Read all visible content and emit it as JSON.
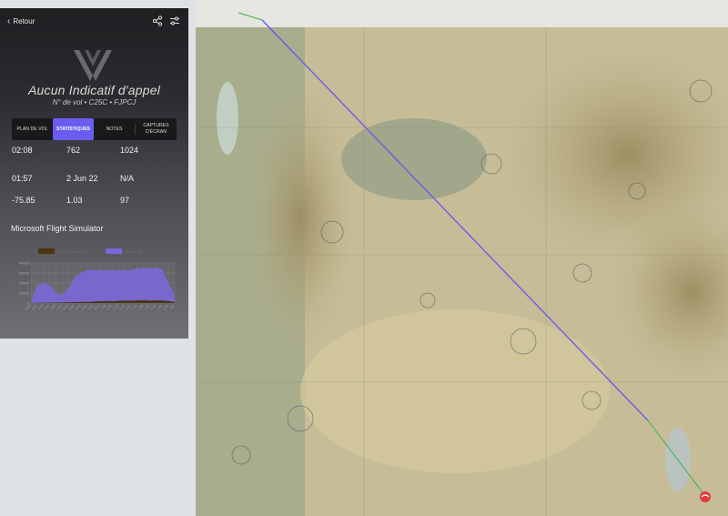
{
  "header": {
    "back_label": "Retour",
    "share_icon": "share-icon",
    "settings_icon": "sliders-icon"
  },
  "flight": {
    "callsign": "Aucun Indicatif d'appel",
    "subtitle": "N° de vol • C25C • FJPCJ"
  },
  "tabs": [
    {
      "label": "PLAN DE VOL",
      "active": false
    },
    {
      "label": "STATISTIQUES",
      "active": true
    },
    {
      "label": "NOTES",
      "active": false
    },
    {
      "label": "CAPTURES D'ÉCRAN",
      "active": false
    }
  ],
  "stats": [
    [
      "02:08",
      "762",
      "1024"
    ],
    [
      "01:57",
      "2 Jun 22",
      "N/A"
    ],
    [
      "-75.85",
      "1.03",
      "97"
    ]
  ],
  "simulator": "Microsoft Flight Simulator",
  "chart_data": {
    "type": "area",
    "series": [
      {
        "name": "Ground Elevation (ft)",
        "color": "#4a3412",
        "values": [
          0,
          200,
          300,
          500,
          400,
          600,
          800,
          900,
          1200,
          1000,
          1500,
          1800,
          2000,
          1700,
          2200,
          2500,
          2300,
          2600,
          2800,
          2400,
          2700,
          2500,
          2000,
          1000
        ]
      },
      {
        "name": "Altitude (ft)",
        "color": "#7a68d8",
        "values": [
          0,
          18000,
          20000,
          18000,
          10000,
          8000,
          15000,
          26000,
          30000,
          33000,
          33000,
          33000,
          33000,
          33000,
          33000,
          33000,
          33000,
          35000,
          35000,
          35000,
          35000,
          34000,
          20000,
          8000
        ]
      }
    ],
    "ylim": [
      0,
      40000
    ],
    "yticks": [
      "40000",
      "30000",
      "20000",
      "10000",
      "0"
    ],
    "xticks": [
      "0:00",
      "0:05",
      "0:10",
      "0:15",
      "0:20",
      "0:25",
      "0:30",
      "0:35",
      "0:40",
      "0:45",
      "0:50",
      "0:55",
      "1:00",
      "1:05",
      "1:10",
      "1:15",
      "1:20",
      "1:25",
      "1:30",
      "1:35",
      "1:40",
      "1:45",
      "1:50",
      "1:55"
    ],
    "grid": true,
    "legend": "top-center"
  },
  "map": {
    "route_color": "#6b5ce6",
    "alt_route_color": "#37b24d"
  }
}
